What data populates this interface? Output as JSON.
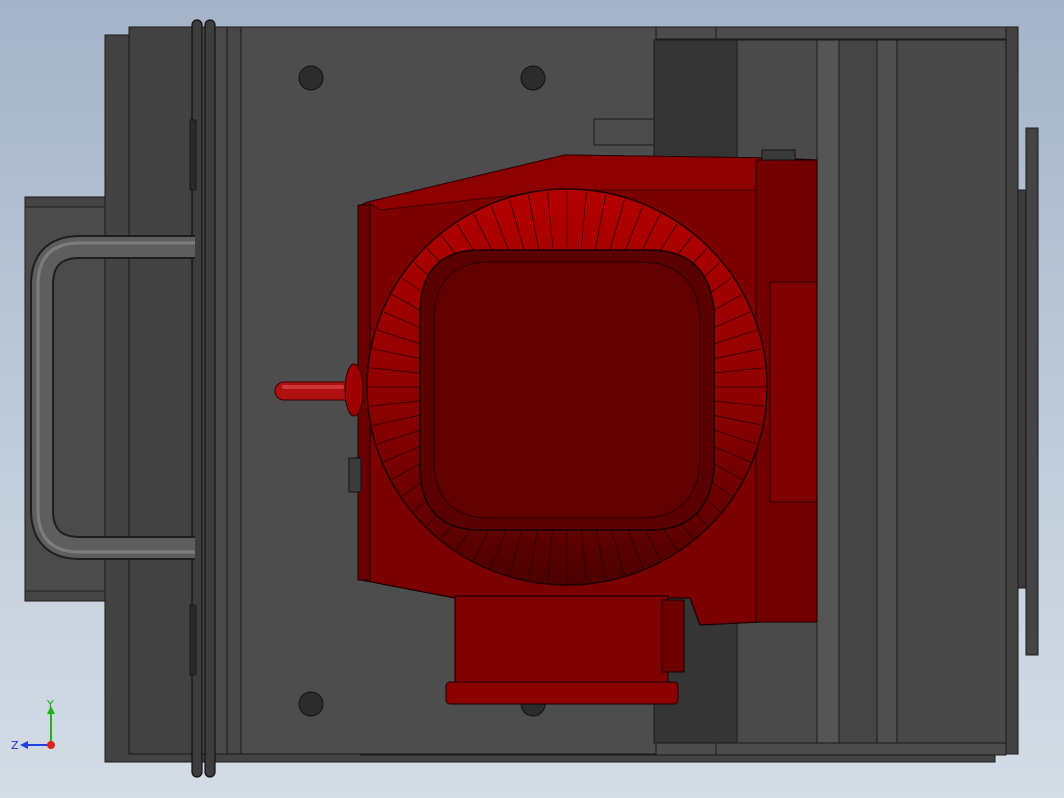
{
  "app": {
    "view": "top"
  },
  "colors": {
    "background_top": "#a4b3c8",
    "background_bottom": "#d4dce6",
    "frame_dark": "#3e3e3e",
    "frame_mid": "#4a4a4a",
    "frame_light": "#565656",
    "edge": "#1a1a1a",
    "motor_red": "#7a0000",
    "motor_red_light": "#a80000",
    "motor_red_dark": "#5a0000",
    "axis_x": "#e02020",
    "axis_y": "#20b020",
    "axis_z": "#2040e0"
  },
  "triad": {
    "y_label": "Y",
    "z_label": "Z"
  }
}
